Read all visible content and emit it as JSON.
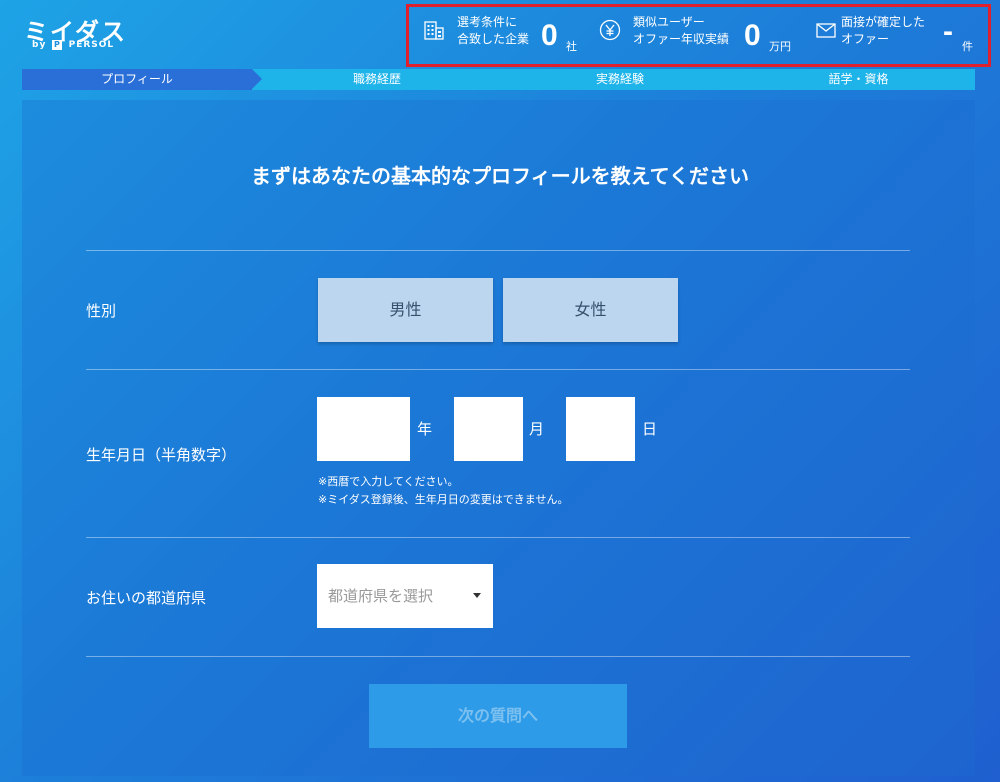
{
  "logo": {
    "main": "ミイダス",
    "by": "by",
    "brand": "PERSOL"
  },
  "stats": [
    {
      "icon": "building-icon",
      "label_line1": "選考条件に",
      "label_line2": "合致した企業",
      "value": "0",
      "unit": "社"
    },
    {
      "icon": "yen-icon",
      "label_line1": "類似ユーザー",
      "label_line2": "オファー年収実績",
      "value": "0",
      "unit": "万円"
    },
    {
      "icon": "mail-icon",
      "label_line1": "面接が確定した",
      "label_line2": "オファー",
      "value": "-",
      "unit": "件"
    }
  ],
  "steps": [
    {
      "label": "プロフィール",
      "active": true
    },
    {
      "label": "職務経歴",
      "active": false
    },
    {
      "label": "実務経験",
      "active": false
    },
    {
      "label": "語学・資格",
      "active": false
    }
  ],
  "form": {
    "title": "まずはあなたの基本的なプロフィールを教えてください",
    "gender_label": "性別",
    "gender_male": "男性",
    "gender_female": "女性",
    "birth_label": "生年月日（半角数字）",
    "year_unit": "年",
    "month_unit": "月",
    "day_unit": "日",
    "year_value": "",
    "month_value": "",
    "day_value": "",
    "note1": "※西暦で入力してください。",
    "note2": "※ミイダス登録後、生年月日の変更はできません。",
    "pref_label": "お住いの都道府県",
    "pref_placeholder": "都道府県を選択",
    "next_button": "次の質問へ"
  },
  "colors": {
    "alert_border": "#e0202c",
    "active_step": "#2a6fd8",
    "step_bar": "#1eb4ea"
  }
}
